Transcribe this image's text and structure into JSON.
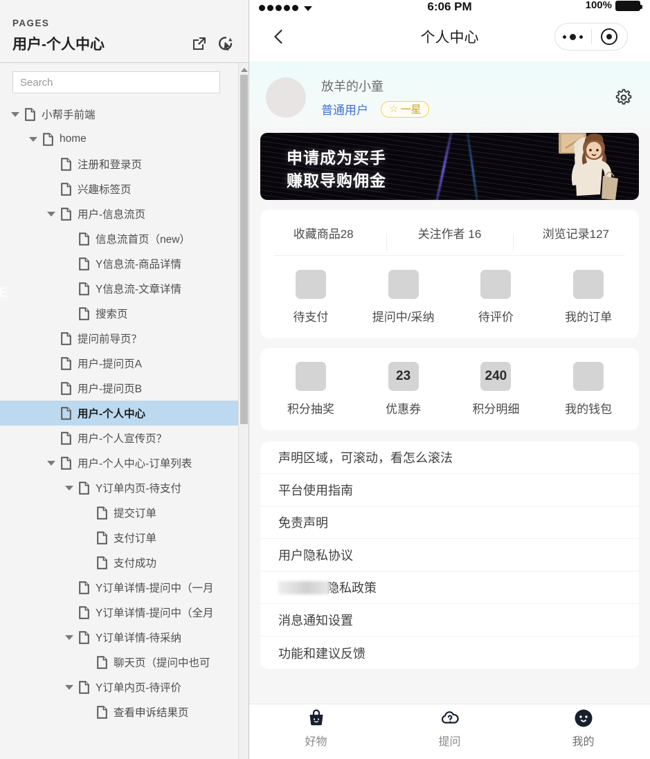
{
  "sidebar": {
    "eyebrow": "PAGES",
    "title": "用户-个人中心",
    "actions": [
      {
        "name": "open-external-icon",
        "label": "打开"
      },
      {
        "name": "preview-icon",
        "label": "预览"
      }
    ],
    "search": {
      "placeholder": "Search",
      "value": ""
    },
    "edge_letter": "E",
    "tree": [
      {
        "label": "小帮手前端",
        "depth": 0,
        "twisty": "open",
        "selected": false
      },
      {
        "label": "home",
        "depth": 1,
        "twisty": "open",
        "selected": false
      },
      {
        "label": "注册和登录页",
        "depth": 2,
        "twisty": "none",
        "selected": false
      },
      {
        "label": "兴趣标签页",
        "depth": 2,
        "twisty": "none",
        "selected": false
      },
      {
        "label": "用户-信息流页",
        "depth": 2,
        "twisty": "open",
        "selected": false
      },
      {
        "label": "信息流首页（new）",
        "depth": 3,
        "twisty": "none",
        "selected": false
      },
      {
        "label": "Y信息流-商品详情",
        "depth": 3,
        "twisty": "none",
        "selected": false
      },
      {
        "label": "Y信息流-文章详情",
        "depth": 3,
        "twisty": "none",
        "selected": false
      },
      {
        "label": "搜索页",
        "depth": 3,
        "twisty": "none",
        "selected": false
      },
      {
        "label": "提问前导页？",
        "depth": 2,
        "twisty": "none",
        "selected": false
      },
      {
        "label": "用户-提问页A",
        "depth": 2,
        "twisty": "none",
        "selected": false
      },
      {
        "label": "用户-提问页B",
        "depth": 2,
        "twisty": "none",
        "selected": false
      },
      {
        "label": "用户-个人中心",
        "depth": 2,
        "twisty": "none",
        "selected": true
      },
      {
        "label": "用户-个人宣传页？",
        "depth": 2,
        "twisty": "none",
        "selected": false
      },
      {
        "label": "用户-个人中心-订单列表",
        "depth": 2,
        "twisty": "open",
        "selected": false
      },
      {
        "label": "Y订单内页-待支付",
        "depth": 3,
        "twisty": "open",
        "selected": false
      },
      {
        "label": "提交订单",
        "depth": 4,
        "twisty": "none",
        "selected": false
      },
      {
        "label": "支付订单",
        "depth": 4,
        "twisty": "none",
        "selected": false
      },
      {
        "label": "支付成功",
        "depth": 4,
        "twisty": "none",
        "selected": false
      },
      {
        "label": "Y订单详情-提问中（一月",
        "depth": 3,
        "twisty": "none",
        "selected": false
      },
      {
        "label": "Y订单详情-提问中（全月",
        "depth": 3,
        "twisty": "none",
        "selected": false
      },
      {
        "label": "Y订单详情-待采纳",
        "depth": 3,
        "twisty": "open",
        "selected": false
      },
      {
        "label": "聊天页（提问中也可",
        "depth": 4,
        "twisty": "none",
        "selected": false
      },
      {
        "label": "Y订单内页-待评价",
        "depth": 3,
        "twisty": "open",
        "selected": false
      },
      {
        "label": "查看申诉结果页",
        "depth": 4,
        "twisty": "none",
        "selected": false
      }
    ]
  },
  "phone": {
    "statusbar": {
      "time": "6:06 PM",
      "battery_pct": "100%",
      "signal_dots": 5
    },
    "navbar": {
      "title": "个人中心",
      "back_icon": "chevron-left-icon",
      "menu_icon": "more-dots-icon",
      "target_icon": "target-circle-icon"
    },
    "profile": {
      "name": "放羊的小童",
      "role": "普通用户",
      "badge": "一星",
      "badge_star": "☆",
      "settings_icon": "gear-icon",
      "badge_color": "#e8c84a",
      "role_color": "#3f6fd8"
    },
    "banner": {
      "line1": "申请成为买手",
      "line2": "赚取导购佣金",
      "background_color": "#08060c"
    },
    "stats": [
      {
        "label": "收藏商品28"
      },
      {
        "label": "关注作者 16"
      },
      {
        "label": "浏览记录127"
      }
    ],
    "orders_grid": [
      {
        "label": "待支付",
        "badge": ""
      },
      {
        "label": "提问中/采纳",
        "badge": ""
      },
      {
        "label": "待评价",
        "badge": ""
      },
      {
        "label": "我的订单",
        "badge": ""
      }
    ],
    "points_grid": [
      {
        "label": "积分抽奖",
        "badge": ""
      },
      {
        "label": "优惠券",
        "badge": "23"
      },
      {
        "label": "积分明细",
        "badge": "240"
      },
      {
        "label": "我的钱包",
        "badge": ""
      }
    ],
    "list": [
      {
        "label": "声明区域，可滚动，看怎么滚法",
        "redacted": false
      },
      {
        "label": "平台使用指南",
        "redacted": false
      },
      {
        "label": "免责声明",
        "redacted": false
      },
      {
        "label": "用户隐私协议",
        "redacted": false
      },
      {
        "label": "隐私政策",
        "redacted": true
      },
      {
        "label": "消息通知设置",
        "redacted": false
      },
      {
        "label": "功能和建议反馈",
        "redacted": false
      }
    ],
    "tabbar": [
      {
        "label": "好物",
        "icon": "basket-icon",
        "active": false
      },
      {
        "label": "提问",
        "icon": "cloud-question-icon",
        "active": false
      },
      {
        "label": "我的",
        "icon": "face-icon",
        "active": true
      }
    ]
  }
}
